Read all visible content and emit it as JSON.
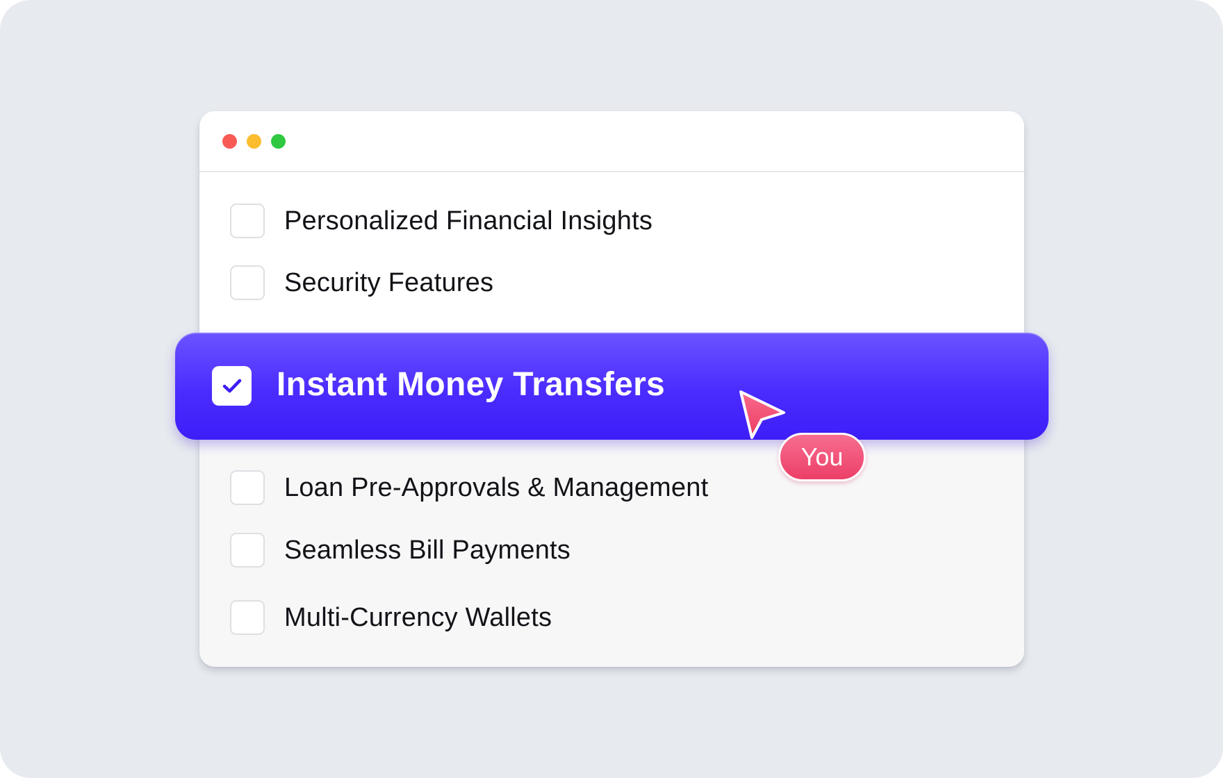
{
  "window": {
    "controls": [
      "close",
      "minimize",
      "zoom"
    ]
  },
  "list": {
    "items": [
      {
        "label": "Personalized Financial Insights",
        "checked": false
      },
      {
        "label": "Security Features",
        "checked": false
      },
      {
        "label": "Instant Money Transfers",
        "checked": true
      },
      {
        "label": "Loan Pre-Approvals & Management",
        "checked": false
      },
      {
        "label": "Seamless Bill Payments",
        "checked": false
      },
      {
        "label": "Multi-Currency Wallets",
        "checked": false
      }
    ]
  },
  "cursor": {
    "label": "You",
    "icon": "pointer-arrow-icon",
    "color": "#f2456e"
  },
  "colors": {
    "accent": "#4a2cff",
    "background": "#e7eaef",
    "close": "#f85a54",
    "minimize": "#fbbd2e",
    "zoom": "#2fc840"
  }
}
